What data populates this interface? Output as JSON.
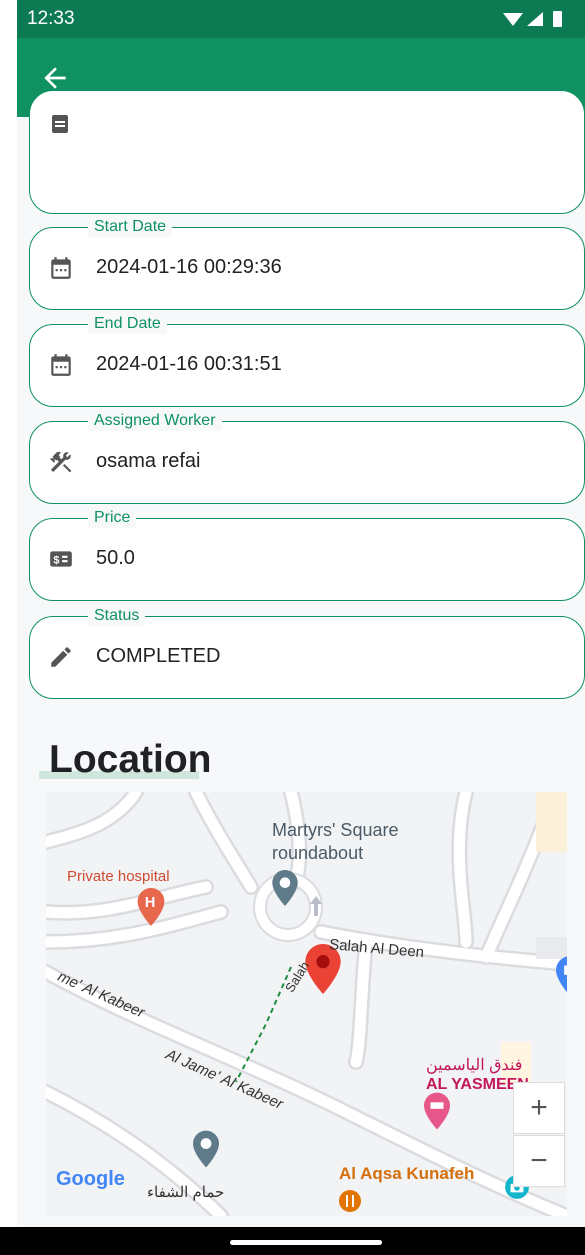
{
  "status_bar": {
    "time": "12:33"
  },
  "fields": [
    {
      "label": "Start Date",
      "value": "2024-01-16 00:29:36",
      "icon": "calendar-icon"
    },
    {
      "label": "End Date",
      "value": "2024-01-16 00:31:51",
      "icon": "calendar-icon"
    },
    {
      "label": "Assigned Worker",
      "value": "osama refai",
      "icon": "tools-icon"
    },
    {
      "label": "Price",
      "value": "50.0",
      "icon": "price-icon"
    },
    {
      "label": "Status",
      "value": "COMPLETED",
      "icon": "pencil-icon"
    }
  ],
  "location_title": "Location",
  "map": {
    "labels": {
      "martyrs1": "Martyrs' Square",
      "martyrs2": "roundabout",
      "hospital": "Private hospital",
      "salah_deen": "Salah Al Deen",
      "salah_short": "Salah",
      "jame1": "me' Al Kabeer",
      "jame2": "Al Jame' Al Kabeer",
      "yasmeen_ar": "فندق الياسمين",
      "yasmeen_en": "AL YASMEEN",
      "aqsa": "Al Aqsa Kunafeh",
      "shifa_ar": "حمام الشفاء",
      "google": "Google"
    },
    "zoom_in": "+",
    "zoom_out": "−"
  },
  "colors": {
    "primary": "#0f9161",
    "status_bar": "#0c7a52",
    "marker": "#ea4335"
  }
}
